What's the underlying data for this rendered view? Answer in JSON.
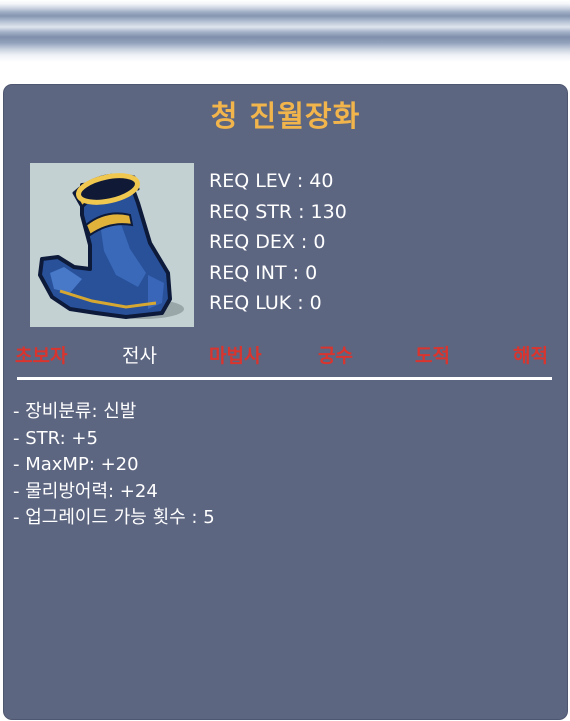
{
  "item": {
    "name": "청 진월장화",
    "icon": "blue-boots-icon"
  },
  "requirements": [
    "REQ LEV : 40",
    "REQ STR : 130",
    "REQ DEX : 0",
    "REQ INT : 0",
    "REQ LUK : 0"
  ],
  "jobs": [
    {
      "label": "초보자",
      "active": false
    },
    {
      "label": "전사",
      "active": true
    },
    {
      "label": "마법사",
      "active": false
    },
    {
      "label": "궁수",
      "active": false
    },
    {
      "label": "도적",
      "active": false
    },
    {
      "label": "해적",
      "active": false
    }
  ],
  "stats": [
    "- 장비분류: 신발",
    "- STR: +5",
    "- MaxMP: +20",
    "- 물리방어력: +24",
    "- 업그레이드 가능 횟수 : 5"
  ],
  "colors": {
    "panel": "#5d6681",
    "title": "#f2b54b",
    "job_available": "#ffffff",
    "job_unavailable": "#d9342e"
  }
}
